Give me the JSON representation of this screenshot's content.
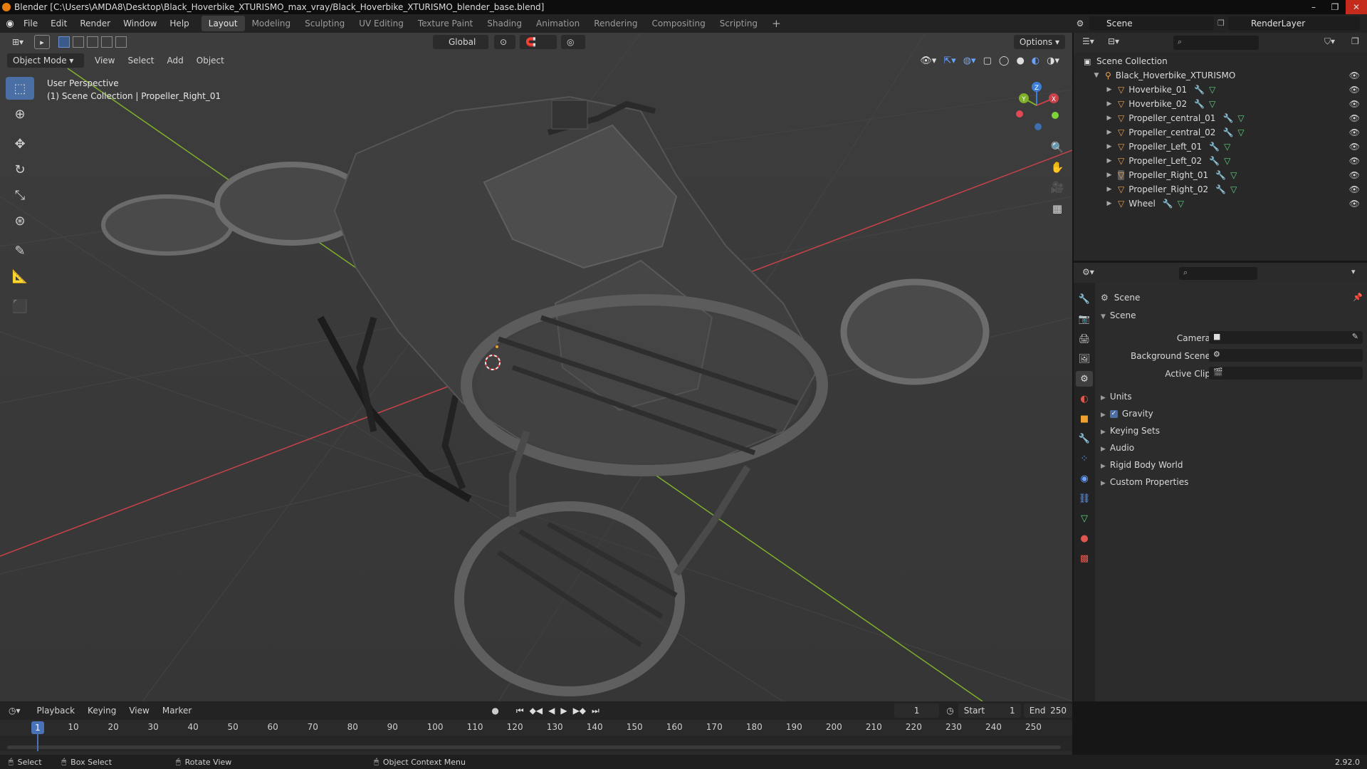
{
  "title_bar": {
    "title": "Blender [C:\\Users\\AMDA8\\Desktop\\Black_Hoverbike_XTURISMO_max_vray/Black_Hoverbike_XTURISMO_blender_base.blend]",
    "controls": [
      "–",
      "❐",
      "✕"
    ]
  },
  "top_menu": [
    "File",
    "Edit",
    "Render",
    "Window",
    "Help"
  ],
  "workspace_tabs": [
    {
      "label": "Layout",
      "active": true
    },
    {
      "label": "Modeling",
      "active": false
    },
    {
      "label": "Sculpting",
      "active": false
    },
    {
      "label": "UV Editing",
      "active": false
    },
    {
      "label": "Texture Paint",
      "active": false
    },
    {
      "label": "Shading",
      "active": false
    },
    {
      "label": "Animation",
      "active": false
    },
    {
      "label": "Rendering",
      "active": false
    },
    {
      "label": "Compositing",
      "active": false
    },
    {
      "label": "Scripting",
      "active": false
    }
  ],
  "add_workspace": "+",
  "scene_selector": "Scene",
  "view_layer_selector": "RenderLayer",
  "viewport_header": {
    "transform_orientation": "Global",
    "options_label": "Options"
  },
  "viewport_tool_header": {
    "mode": "Object Mode",
    "menus": [
      "View",
      "Select",
      "Add",
      "Object"
    ]
  },
  "viewport_info": {
    "line1": "User Perspective",
    "line2": "(1) Scene Collection | Propeller_Right_01"
  },
  "nav_gizmo": {
    "x": "X",
    "y": "Y",
    "z": "Z"
  },
  "outliner": {
    "root": "Scene Collection",
    "collection": "Black_Hoverbike_XTURISMO",
    "objects": [
      {
        "name": "Hoverbike_01",
        "selected": false
      },
      {
        "name": "Hoverbike_02",
        "selected": false
      },
      {
        "name": "Propeller_central_01",
        "selected": false
      },
      {
        "name": "Propeller_central_02",
        "selected": false
      },
      {
        "name": "Propeller_Left_01",
        "selected": false
      },
      {
        "name": "Propeller_Left_02",
        "selected": false
      },
      {
        "name": "Propeller_Right_01",
        "selected": true
      },
      {
        "name": "Propeller_Right_02",
        "selected": false
      },
      {
        "name": "Wheel",
        "selected": false
      }
    ]
  },
  "properties": {
    "context_title": "Scene",
    "panel_title": "Scene",
    "fields": [
      {
        "label": "Camera",
        "value": ""
      },
      {
        "label": "Background Scene",
        "value": ""
      },
      {
        "label": "Active Clip",
        "value": ""
      }
    ],
    "subpanels": [
      {
        "label": "Units",
        "checkbox": false
      },
      {
        "label": "Gravity",
        "checkbox": true
      },
      {
        "label": "Keying Sets",
        "checkbox": false
      },
      {
        "label": "Audio",
        "checkbox": false
      },
      {
        "label": "Rigid Body World",
        "checkbox": false
      },
      {
        "label": "Custom Properties",
        "checkbox": false
      }
    ]
  },
  "timeline": {
    "menus": [
      "Playback",
      "Keying",
      "View",
      "Marker"
    ],
    "current_frame": "1",
    "start_label": "Start",
    "start_value": "1",
    "end_label": "End",
    "end_value": "250",
    "ruler": [
      "1",
      "10",
      "20",
      "30",
      "40",
      "50",
      "60",
      "70",
      "80",
      "90",
      "100",
      "110",
      "120",
      "130",
      "140",
      "150",
      "160",
      "170",
      "180",
      "190",
      "200",
      "210",
      "220",
      "230",
      "240",
      "250"
    ]
  },
  "status_bar": {
    "items": [
      "Select",
      "Box Select",
      "Rotate View",
      "Object Context Menu"
    ],
    "version": "2.92.0"
  },
  "colors": {
    "accent": "#4a72b8",
    "axis_x": "#c9424a",
    "axis_y": "#7fb02a",
    "axis_z": "#3b7fd9",
    "object_icon": "#e8a24a",
    "modifier_icon": "#6aa3ff",
    "mesh_icon": "#5fd07b"
  }
}
